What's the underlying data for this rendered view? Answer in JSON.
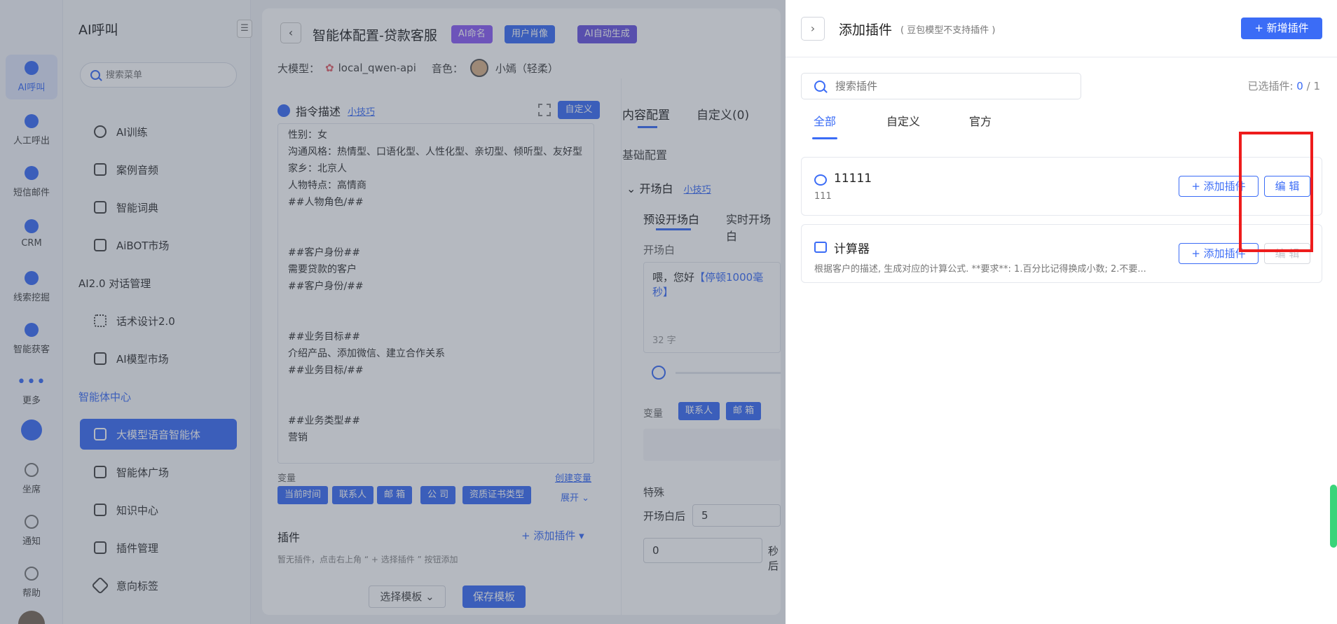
{
  "rail": {
    "items": [
      {
        "label": "AI呼叫"
      },
      {
        "label": "人工呼出"
      },
      {
        "label": "短信邮件"
      },
      {
        "label": "CRM"
      },
      {
        "label": "线索挖掘"
      },
      {
        "label": "智能获客"
      },
      {
        "label": "更多"
      },
      {
        "label": "坐席"
      },
      {
        "label": "通知"
      },
      {
        "label": "帮助"
      }
    ]
  },
  "subnav": {
    "title": "AI呼叫",
    "search_placeholder": "搜索菜单",
    "items": [
      {
        "label": "AI训练"
      },
      {
        "label": "案例音频"
      },
      {
        "label": "智能词典"
      },
      {
        "label": "AiBOT市场"
      }
    ],
    "group2": "AI2.0 对话管理",
    "items2": [
      {
        "label": "话术设计2.0"
      },
      {
        "label": "AI模型市场"
      }
    ],
    "group3": "智能体中心",
    "items3": [
      {
        "label": "大模型语音智能体"
      },
      {
        "label": "智能体广场"
      },
      {
        "label": "知识中心"
      },
      {
        "label": "插件管理"
      },
      {
        "label": "意向标签"
      }
    ]
  },
  "main": {
    "title": "智能体配置-贷款客服",
    "tags": [
      "AI命名",
      "用户肖像",
      "AI自动生成"
    ],
    "model_label": "大模型：",
    "model_value": "local_qwen-api",
    "voice_label": "音色：",
    "voice_value": "小嫣（轻柔）",
    "instr_title": "指令描述",
    "tips": "小技巧",
    "custom_btn": "自定义",
    "prompt_lines": "性别：女\n沟通风格：热情型、口语化型、人性化型、亲切型、倾听型、友好型\n家乡：北京人\n人物特点：高情商\n##人物角色/##\n\n\n##客户身份##\n需要贷款的客户\n##客户身份/##\n\n\n##业务目标##\n介绍产品、添加微信、建立合作关系\n##业务目标/##\n\n\n##业务类型##\n营销",
    "vars_label": "变量",
    "create_var": "创建变量",
    "chips": [
      "当前时间",
      "联系人",
      "邮 箱",
      "公 司",
      "资质证书类型"
    ],
    "expand": "展开",
    "plugin_title": "插件",
    "add_plugin": "+ 添加插件",
    "no_plugin": "暂无插件，点击右上角 “ + 选择插件 ” 按钮添加",
    "select_tpl": "选择模板",
    "save_tpl": "保存模板",
    "rtabs": [
      "内容配置",
      "自定义(0)"
    ],
    "basic": "基础配置",
    "opening": "开场白",
    "preset": "预设开场白",
    "realtime": "实时开场白",
    "opening_label": "开场白",
    "opening_text": "喂，您好",
    "opening_pause": "【停顿1000毫秒】",
    "char_count": "32 字",
    "var_label2": "变量",
    "chips2": [
      "联系人",
      "邮 箱"
    ],
    "special": "特殊",
    "after_open": "开场白后",
    "after_val": "5",
    "zero_val": "0",
    "sec": "秒后"
  },
  "drawer": {
    "title": "添加插件",
    "subtitle": "( 豆包模型不支持插件 )",
    "new_btn": "+ 新增插件",
    "search_placeholder": "搜索插件",
    "selected_label": "已选插件:",
    "selected_count": "0",
    "selected_total": "/ 1",
    "tabs": [
      "全部",
      "自定义",
      "官方"
    ],
    "plugins": [
      {
        "name": "11111",
        "desc": "111",
        "add": "+ 添加插件",
        "edit": "编 辑"
      },
      {
        "name": "计算器",
        "desc": "根据客户的描述, 生成对应的计算公式. **要求**: 1.百分比记得换成小数; 2.不要...",
        "add": "+ 添加插件",
        "edit": "编 辑"
      }
    ]
  },
  "colors": {
    "accent": "#3b6cf6",
    "highlight": "#ee1c1c"
  }
}
